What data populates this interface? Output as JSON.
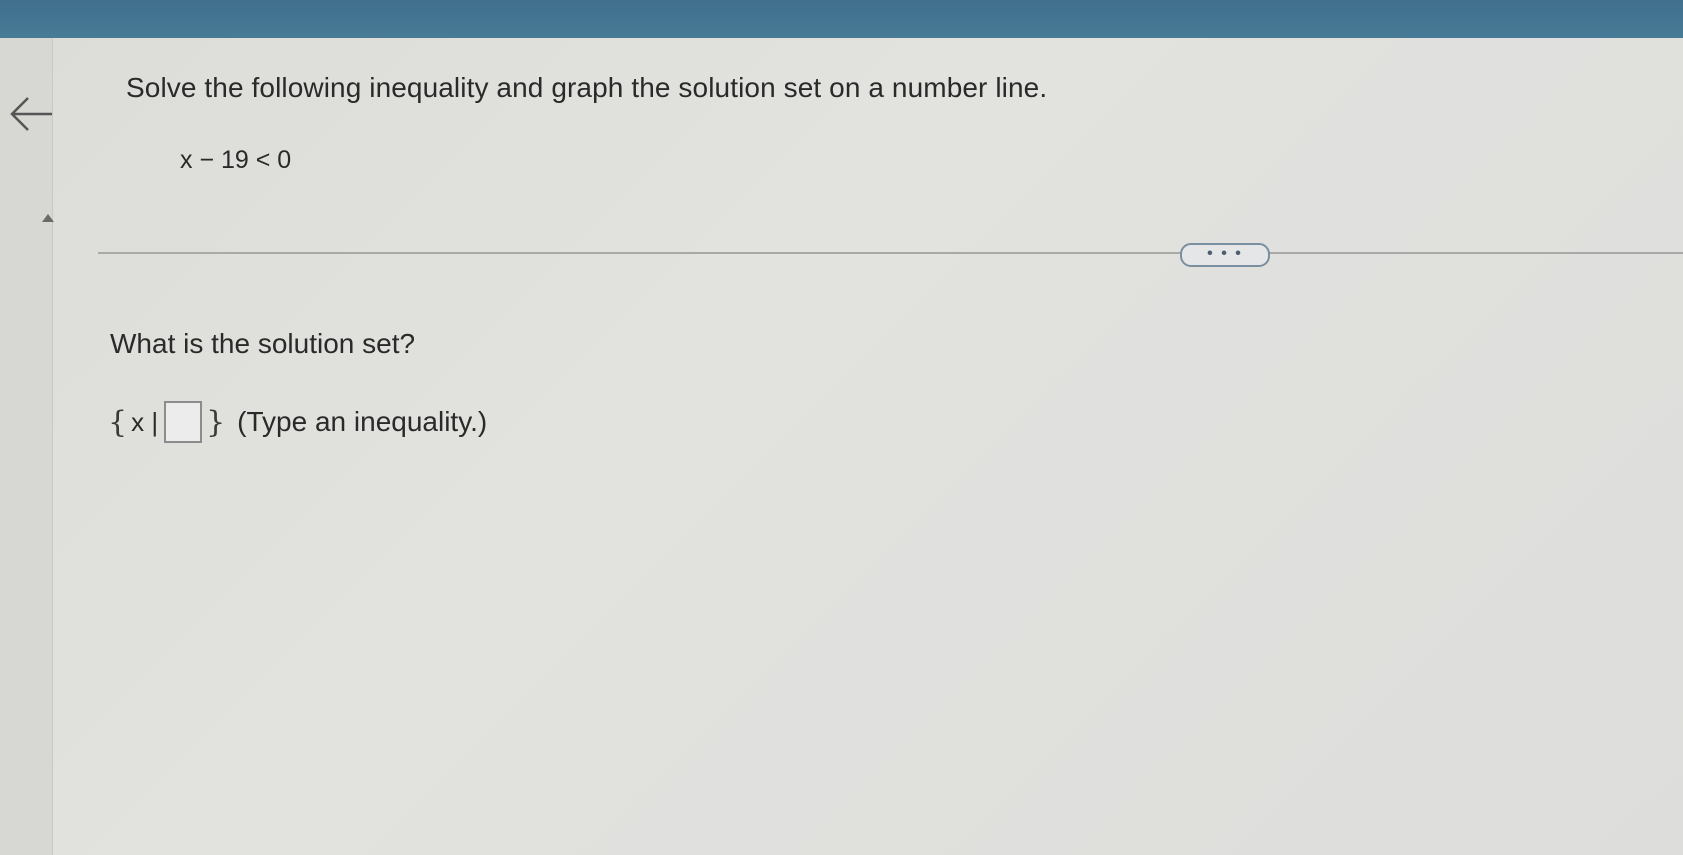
{
  "question": {
    "text": "Solve the following inequality and graph the solution set on a number line.",
    "expression": "x − 19 < 0"
  },
  "more_button": {
    "label": "• • •"
  },
  "answer": {
    "prompt": "What is the solution set?",
    "open_brace": "{",
    "set_variable": "x |",
    "close_brace": "}",
    "input_value": "",
    "hint": "(Type an inequality.)"
  },
  "icons": {
    "back": "left-arrow-icon",
    "collapse": "triangle-up-icon"
  },
  "colors": {
    "top_bar": "#4a7d99",
    "panel": "#dedede",
    "text": "#2a2a2a",
    "more_button_border": "#7a8fa0"
  }
}
